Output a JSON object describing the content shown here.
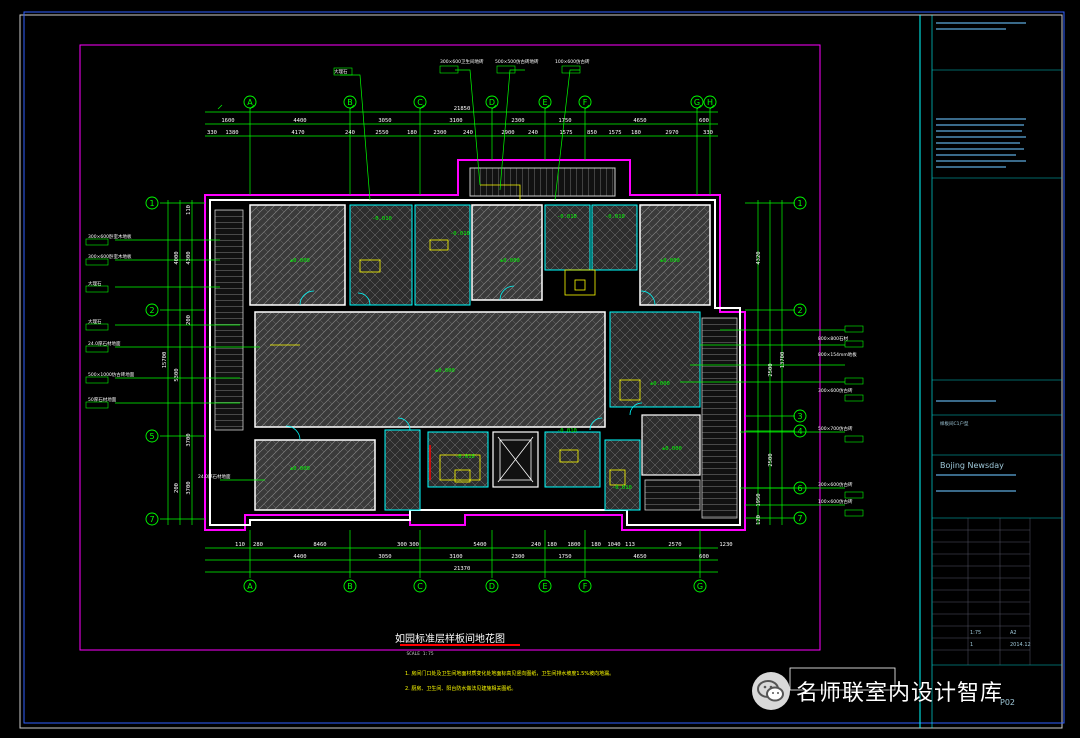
{
  "drawing": {
    "title": "如园标准层样板间地花图",
    "scale": "SCALE   1:75",
    "notes": [
      "1. 房间门口处及卫生间地面材质变化处地面标高见竖向图纸，卫生间排水坡度1.5%坡向地漏。",
      "2. 厨房、卫生间、阳台防水做法见建施相关图纸。"
    ],
    "axes_top": [
      "A",
      "B",
      "C",
      "D",
      "E",
      "F",
      "G",
      "H"
    ],
    "axes_bottom": [
      "A",
      "B",
      "C",
      "D",
      "E",
      "F",
      "G"
    ],
    "axes_left": [
      "1",
      "2",
      "5",
      "7"
    ],
    "axes_right": [
      "1",
      "2",
      "3",
      "4",
      "6",
      "7"
    ],
    "dims_top_total": "21850",
    "dims_top_row1": [
      "1600",
      "4400",
      "3050",
      "3100",
      "2300",
      "1750",
      "4650",
      "600"
    ],
    "dims_top_row2": [
      "330",
      "1380",
      "4170",
      "240",
      "2550",
      "180",
      "2300",
      "240",
      "2900",
      "240",
      "1575",
      "850",
      "1575",
      "180",
      "2970",
      "330"
    ],
    "dims_bottom_row1": [
      "110",
      "280",
      "8460",
      "300",
      "300",
      "5400",
      "240",
      "180",
      "1800",
      "180",
      "1040",
      "113",
      "2570",
      "1230"
    ],
    "dims_bottom_row2": [
      "4400",
      "3050",
      "3100",
      "2300",
      "1750",
      "4650",
      "600"
    ],
    "dims_bottom_total": "21370",
    "dims_left": [
      "110",
      "4000",
      "4300",
      "200",
      "5300",
      "15700",
      "3700",
      "200",
      "3700"
    ],
    "dims_right": [
      "4320",
      "13700",
      "2500",
      "2500",
      "1950",
      "120"
    ],
    "levels": [
      "±0.000",
      "±0.000",
      "±0.000",
      "±0.000",
      "±0.000",
      "±0.000",
      "±0.000",
      "-0.010",
      "-0.010",
      "-0.010",
      "-0.010",
      "-0.010",
      "-0.010",
      "-0.010"
    ],
    "material_tags_left": [
      "300×600卧室木地板",
      "300×600卧室木地板",
      "大理石",
      "大理石",
      "24.0厚石材地面",
      "500×1000仿古砖地面",
      "50厚石材地面",
      "24.0厚石材地面"
    ],
    "material_tags_right": [
      "800×800石材",
      "800×154mm地板",
      "300×600仿古砖",
      "500×700仿古砖",
      "300×600仿古砖",
      "100×600仿古砖"
    ],
    "material_tags_top": [
      "大理石",
      "300×600卫生间地砖",
      "500×500仿古砖地砖",
      "100×600仿古砖"
    ],
    "watermark": "名师联室内设计智库"
  },
  "title_block": {
    "company_en": "Bojing Newsday",
    "drawing_no": "P02",
    "scale": "1:75",
    "date": "2014.12",
    "sheet": "1",
    "stamp_code": "A2",
    "area_label": "样板间C1户型"
  },
  "colors": {
    "background": "#000000",
    "frame": "#ff00ff",
    "walls": "#ffffff",
    "dims": "#00ff00",
    "axis": "#00ff00",
    "floor_hatch": "#909090",
    "fixtures": "#ffff00",
    "cyan_lines": "#00ffff",
    "red_line": "#ff0000"
  }
}
